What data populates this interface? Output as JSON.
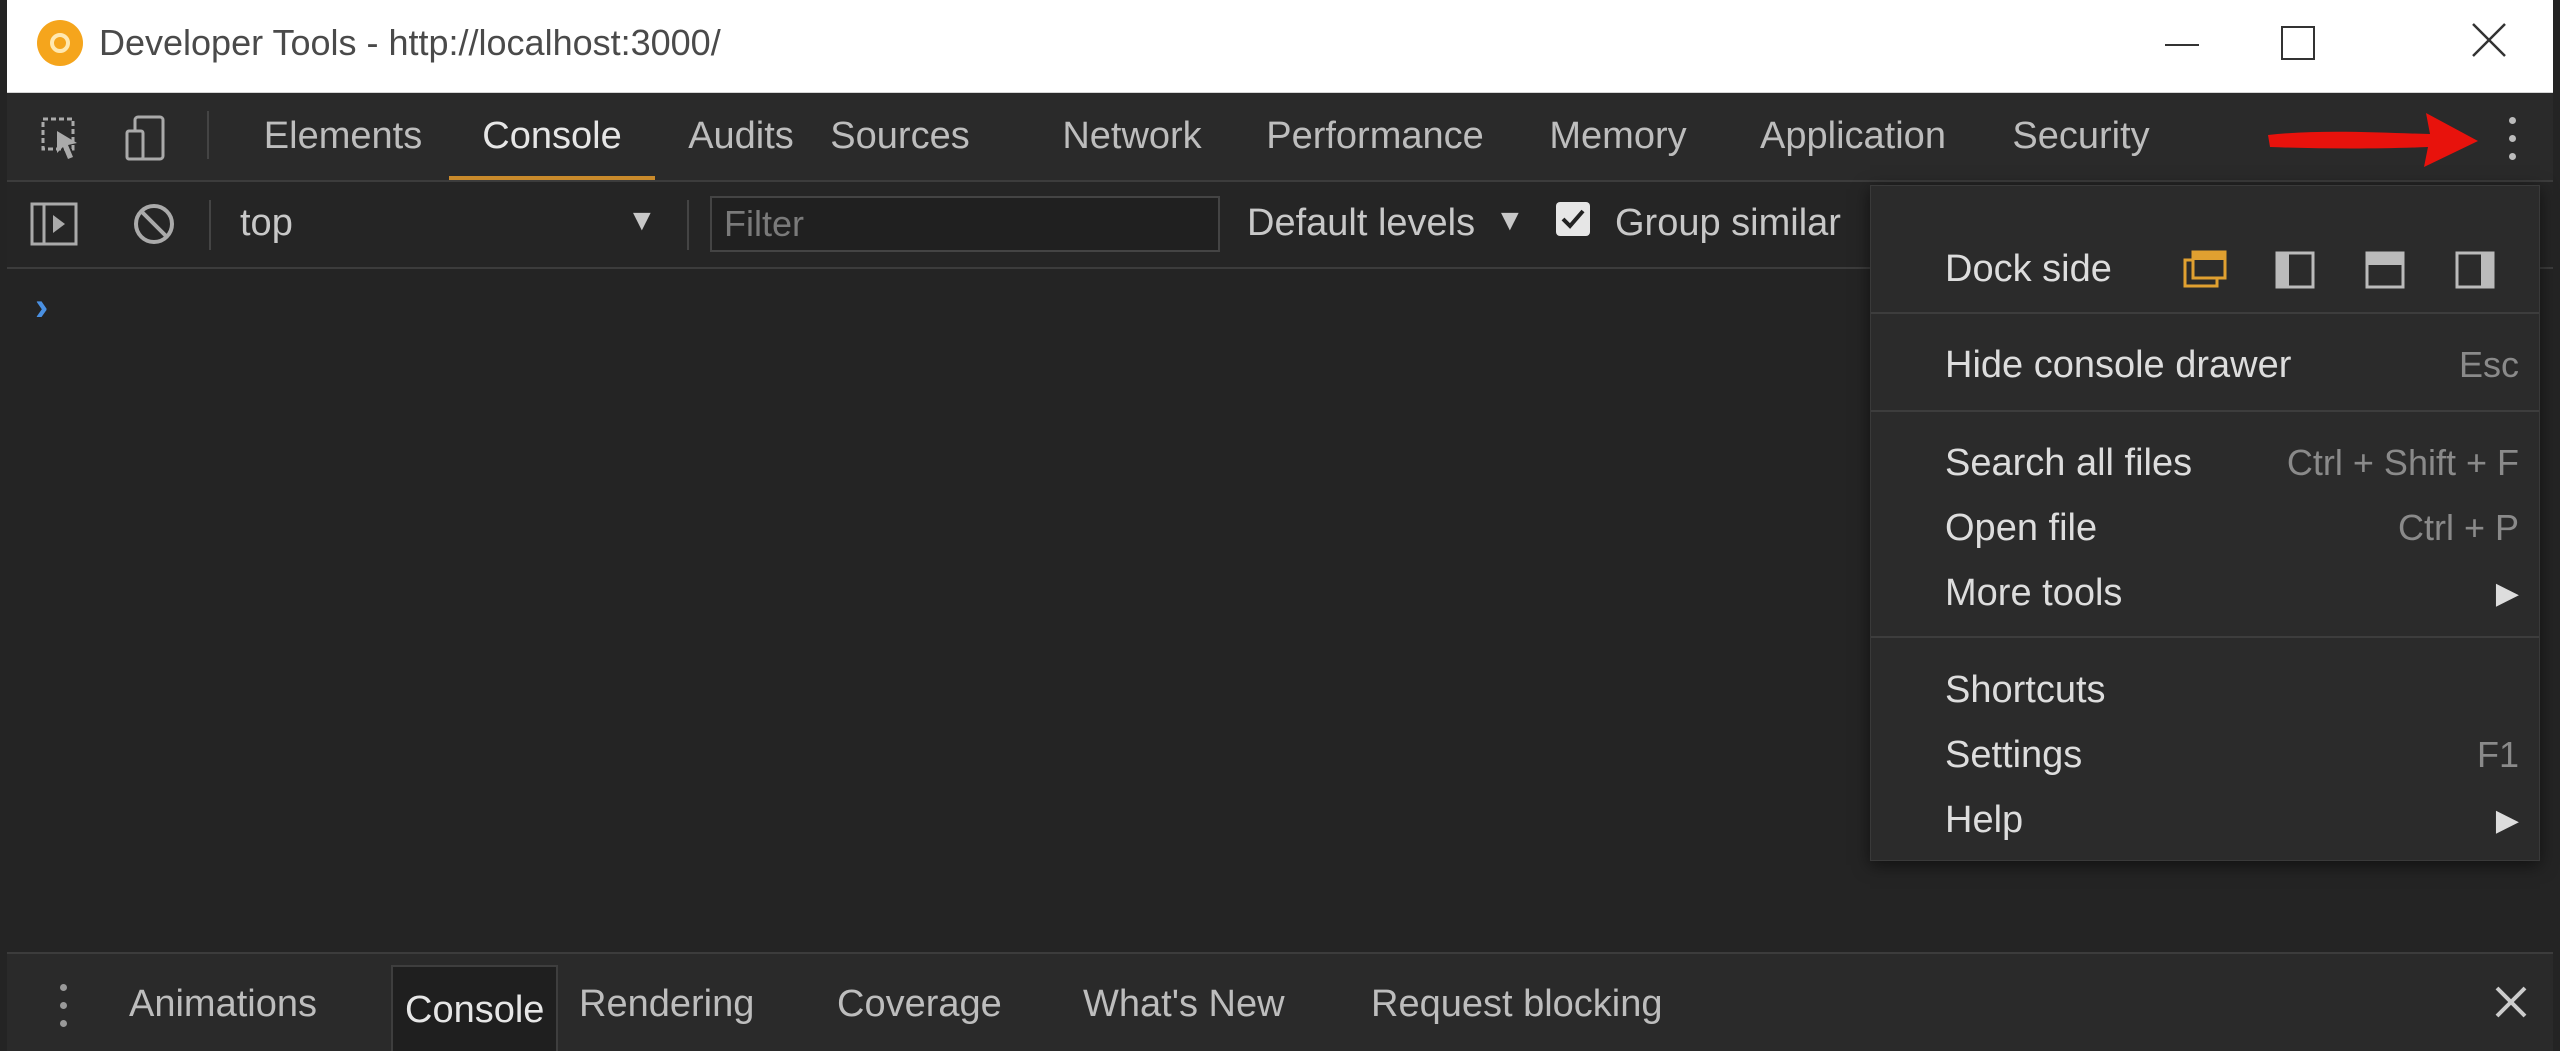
{
  "window": {
    "title": "Developer Tools - http://localhost:3000/",
    "icon": "app-logo-icon"
  },
  "toolbar": {
    "tabs": [
      {
        "label": "Elements"
      },
      {
        "label": "Console",
        "active": true
      },
      {
        "label": "Audits"
      },
      {
        "label": "Sources"
      },
      {
        "label": "Network"
      },
      {
        "label": "Performance"
      },
      {
        "label": "Memory"
      },
      {
        "label": "Application"
      },
      {
        "label": "Security"
      }
    ],
    "icons": [
      "inspect-element-icon",
      "device-toolbar-icon",
      "more-options-icon"
    ]
  },
  "console_toolbar": {
    "context": "top",
    "filter_placeholder": "Filter",
    "levels": "Default levels",
    "group_similar_label": "Group similar",
    "group_similar_checked": true
  },
  "console": {
    "prompt": "›"
  },
  "menu": {
    "dock_side_label": "Dock side",
    "items": [
      {
        "label": "Hide console drawer",
        "shortcut": "Esc"
      },
      {
        "label": "Search all files",
        "shortcut": "Ctrl + Shift + F"
      },
      {
        "label": "Open file",
        "shortcut": "Ctrl + P"
      },
      {
        "label": "More tools",
        "submenu": "▶"
      },
      {
        "label": "Shortcuts",
        "shortcut": ""
      },
      {
        "label": "Settings",
        "shortcut": "F1"
      },
      {
        "label": "Help",
        "submenu": "▶"
      }
    ]
  },
  "drawer": {
    "tabs": [
      {
        "label": "Animations"
      },
      {
        "label": "Console",
        "active": true
      },
      {
        "label": "Rendering"
      },
      {
        "label": "Coverage"
      },
      {
        "label": "What's New"
      },
      {
        "label": "Request blocking"
      }
    ]
  },
  "colors": {
    "accent": "#c98a2b",
    "background": "#242424",
    "annotation_arrow": "#e8120c"
  }
}
